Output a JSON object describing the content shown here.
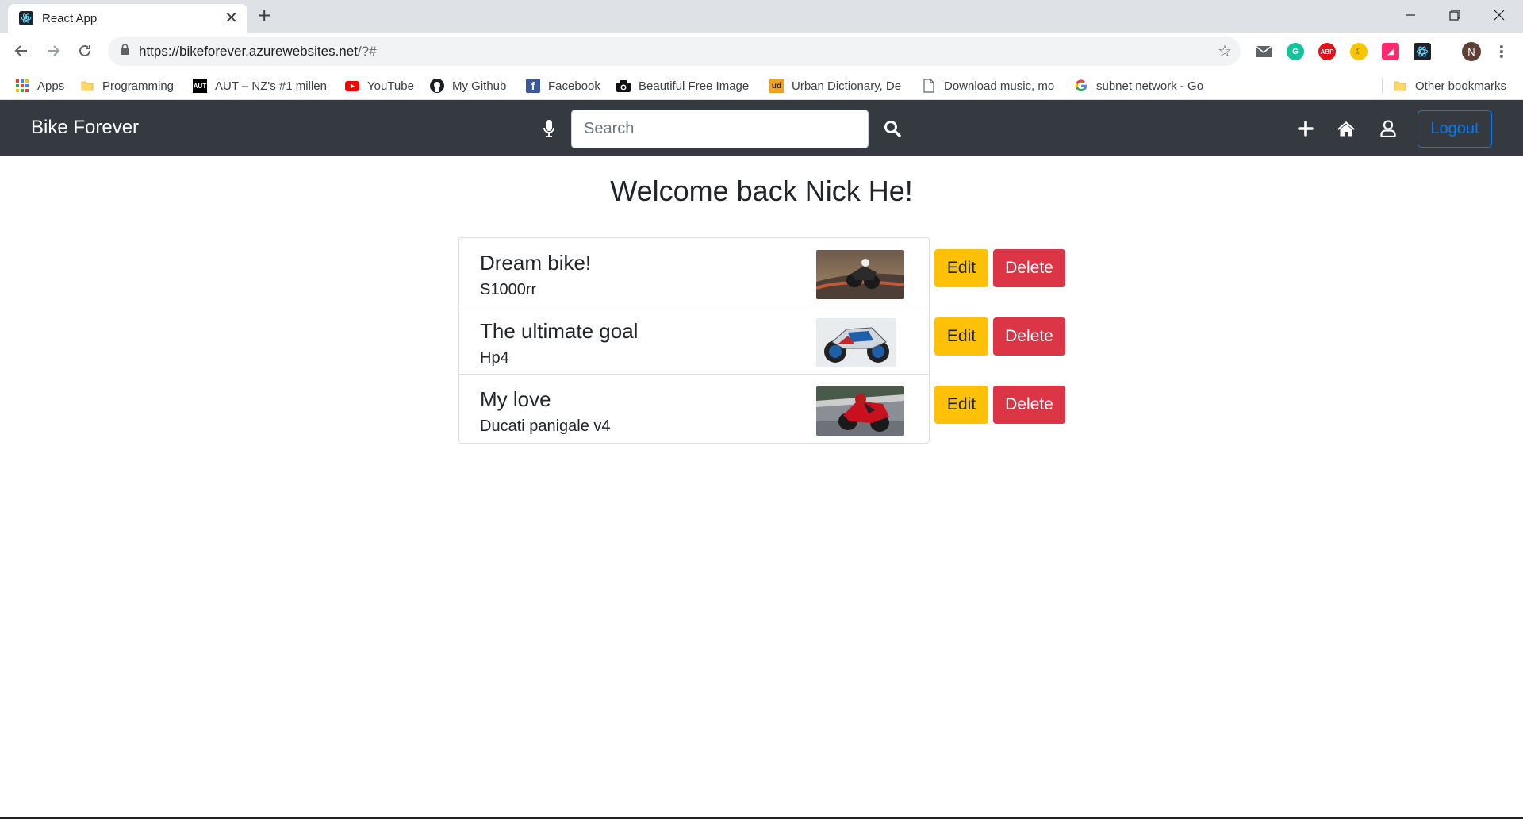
{
  "browser": {
    "tab_title": "React App",
    "url_host": "https://bikeforever.azurewebsites.net",
    "url_path": "/?#",
    "bookmarks": [
      {
        "label": "Apps",
        "icon": "apps-grid-icon"
      },
      {
        "label": "Programming",
        "icon": "folder-icon"
      },
      {
        "label": "AUT – NZ's #1 millen",
        "icon": "aut-logo-icon"
      },
      {
        "label": "YouTube",
        "icon": "youtube-icon"
      },
      {
        "label": "My Github",
        "icon": "github-icon"
      },
      {
        "label": "Facebook",
        "icon": "facebook-icon"
      },
      {
        "label": "Beautiful Free Image",
        "icon": "camera-icon"
      },
      {
        "label": "Urban Dictionary, De",
        "icon": "urban-dictionary-icon"
      },
      {
        "label": "Download music, mo",
        "icon": "page-icon"
      },
      {
        "label": "subnet network - Go",
        "icon": "google-icon"
      }
    ],
    "other_bookmarks": "Other bookmarks",
    "profile_initial": "N"
  },
  "navbar": {
    "brand": "Bike Forever",
    "search_placeholder": "Search",
    "logout_label": "Logout"
  },
  "main": {
    "welcome": "Welcome back Nick He!",
    "edit_label": "Edit",
    "delete_label": "Delete",
    "items": [
      {
        "title": "Dream bike!",
        "subtitle": "S1000rr"
      },
      {
        "title": "The ultimate goal",
        "subtitle": "Hp4"
      },
      {
        "title": "My love",
        "subtitle": "Ducati panigale v4"
      }
    ]
  },
  "colors": {
    "navbar_bg": "#343a40",
    "edit_button": "#ffc107",
    "delete_button": "#dc3545",
    "logout_outline": "#007bff"
  }
}
